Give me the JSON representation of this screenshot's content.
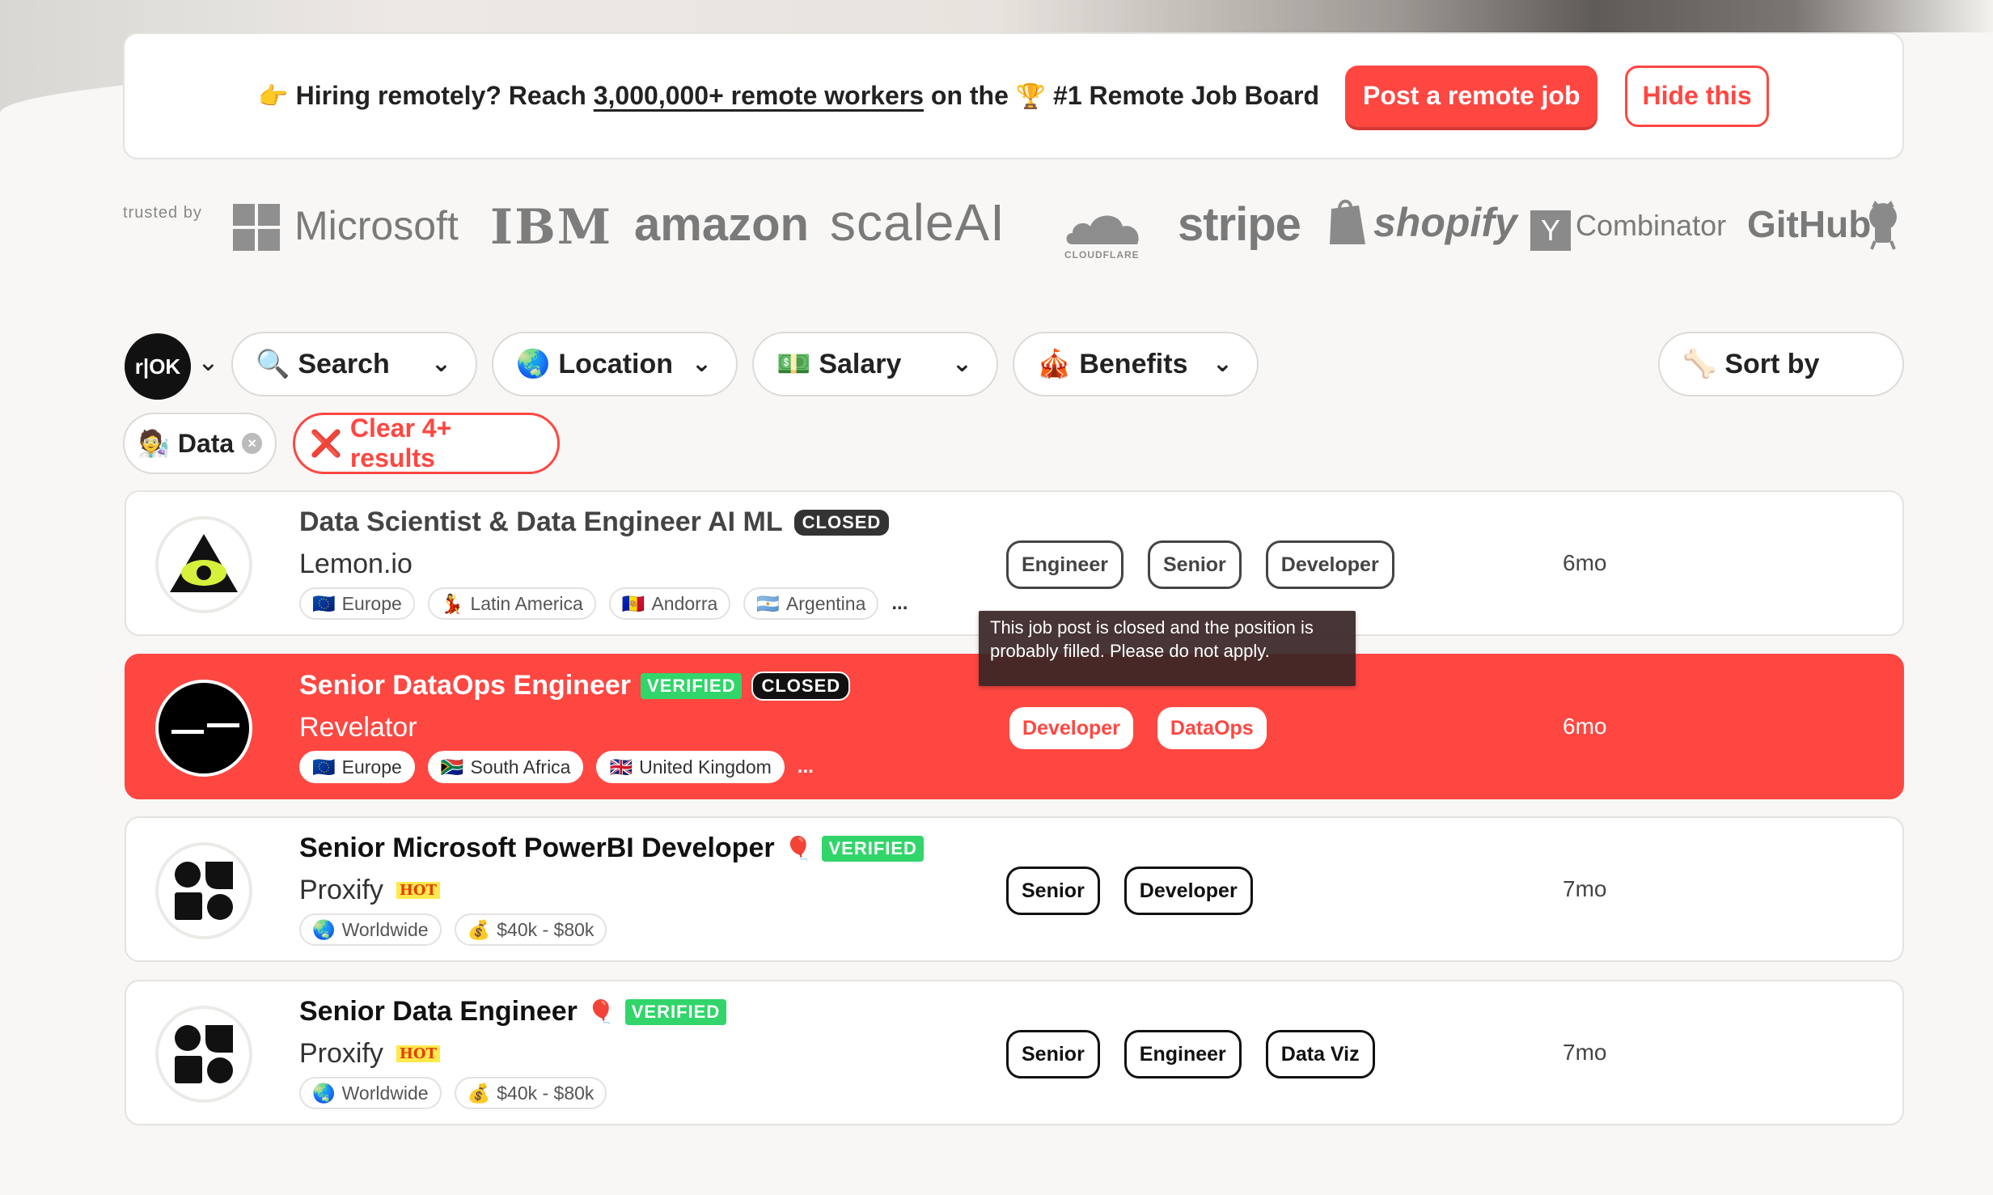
{
  "banner": {
    "pointing_emoji": "👉",
    "text_1": "Hiring remotely? Reach",
    "link_text": "3,000,000+ remote workers",
    "text_2": "on the",
    "trophy_emoji": "🏆",
    "text_3": "#1 Remote Job Board",
    "post_button": "Post a remote job",
    "hide_button": "Hide this"
  },
  "trusted": {
    "label": "trusted by",
    "logos": [
      "Microsoft",
      "IBM",
      "amazon",
      "scaleAI",
      "CLOUDFLARE",
      "stripe",
      "shopify",
      "Y",
      "Combinator",
      "GitHub"
    ]
  },
  "filters": {
    "logo_text": "r|OK",
    "chevron": "⌄",
    "search": {
      "icon": "🔍",
      "label": "Search"
    },
    "location": {
      "icon": "🌏",
      "label": "Location"
    },
    "salary": {
      "icon": "💵",
      "label": "Salary"
    },
    "benefits": {
      "icon": "🎪",
      "label": "Benefits"
    },
    "sort": {
      "icon": "🦴",
      "label": "Sort by"
    }
  },
  "chips": {
    "data": {
      "icon": "🧑‍🔬",
      "label": "Data",
      "remove": "×"
    },
    "clear": {
      "icon": "❌",
      "label": "Clear 4+ results"
    }
  },
  "jobs": [
    {
      "title": "Data Scientist & Data Engineer AI ML",
      "closed": "CLOSED",
      "company": "Lemon.io",
      "locations": [
        {
          "flag": "🇪🇺",
          "name": "Europe"
        },
        {
          "flag": "💃",
          "name": "Latin America"
        },
        {
          "flag": "🇦🇩",
          "name": "Andorra"
        },
        {
          "flag": "🇦🇷",
          "name": "Argentina"
        }
      ],
      "more": "...",
      "tags": [
        "Engineer",
        "Senior",
        "Developer"
      ],
      "age": "6mo"
    },
    {
      "title": "Senior DataOps Engineer",
      "verified": "VERIFIED",
      "closed": "CLOSED",
      "company": "Revelator",
      "locations": [
        {
          "flag": "🇪🇺",
          "name": "Europe"
        },
        {
          "flag": "🇿🇦",
          "name": "South Africa"
        },
        {
          "flag": "🇬🇧",
          "name": "United Kingdom"
        }
      ],
      "more": "...",
      "tags": [
        "Developer",
        "DataOps"
      ],
      "age": "6mo"
    },
    {
      "title": "Senior Microsoft PowerBI Developer",
      "pin": "🎈",
      "verified": "VERIFIED",
      "company": "Proxify",
      "hot": "HOT",
      "locations": [
        {
          "flag": "🌏",
          "name": "Worldwide"
        },
        {
          "flag": "💰",
          "name": "$40k - $80k"
        }
      ],
      "tags": [
        "Senior",
        "Developer"
      ],
      "age": "7mo"
    },
    {
      "title": "Senior Data Engineer",
      "pin": "🎈",
      "verified": "VERIFIED",
      "company": "Proxify",
      "hot": "HOT",
      "locations": [
        {
          "flag": "🌏",
          "name": "Worldwide"
        },
        {
          "flag": "💰",
          "name": "$40k - $80k"
        }
      ],
      "tags": [
        "Senior",
        "Engineer",
        "Data Viz"
      ],
      "age": "7mo"
    }
  ],
  "tooltip": {
    "line_1": "This job post is closed and the position is",
    "line_2": "probably filled. Please do not apply."
  },
  "colors": {
    "accent": "#ff4742",
    "verified": "#31d56a",
    "hot": "#ffe94c"
  }
}
